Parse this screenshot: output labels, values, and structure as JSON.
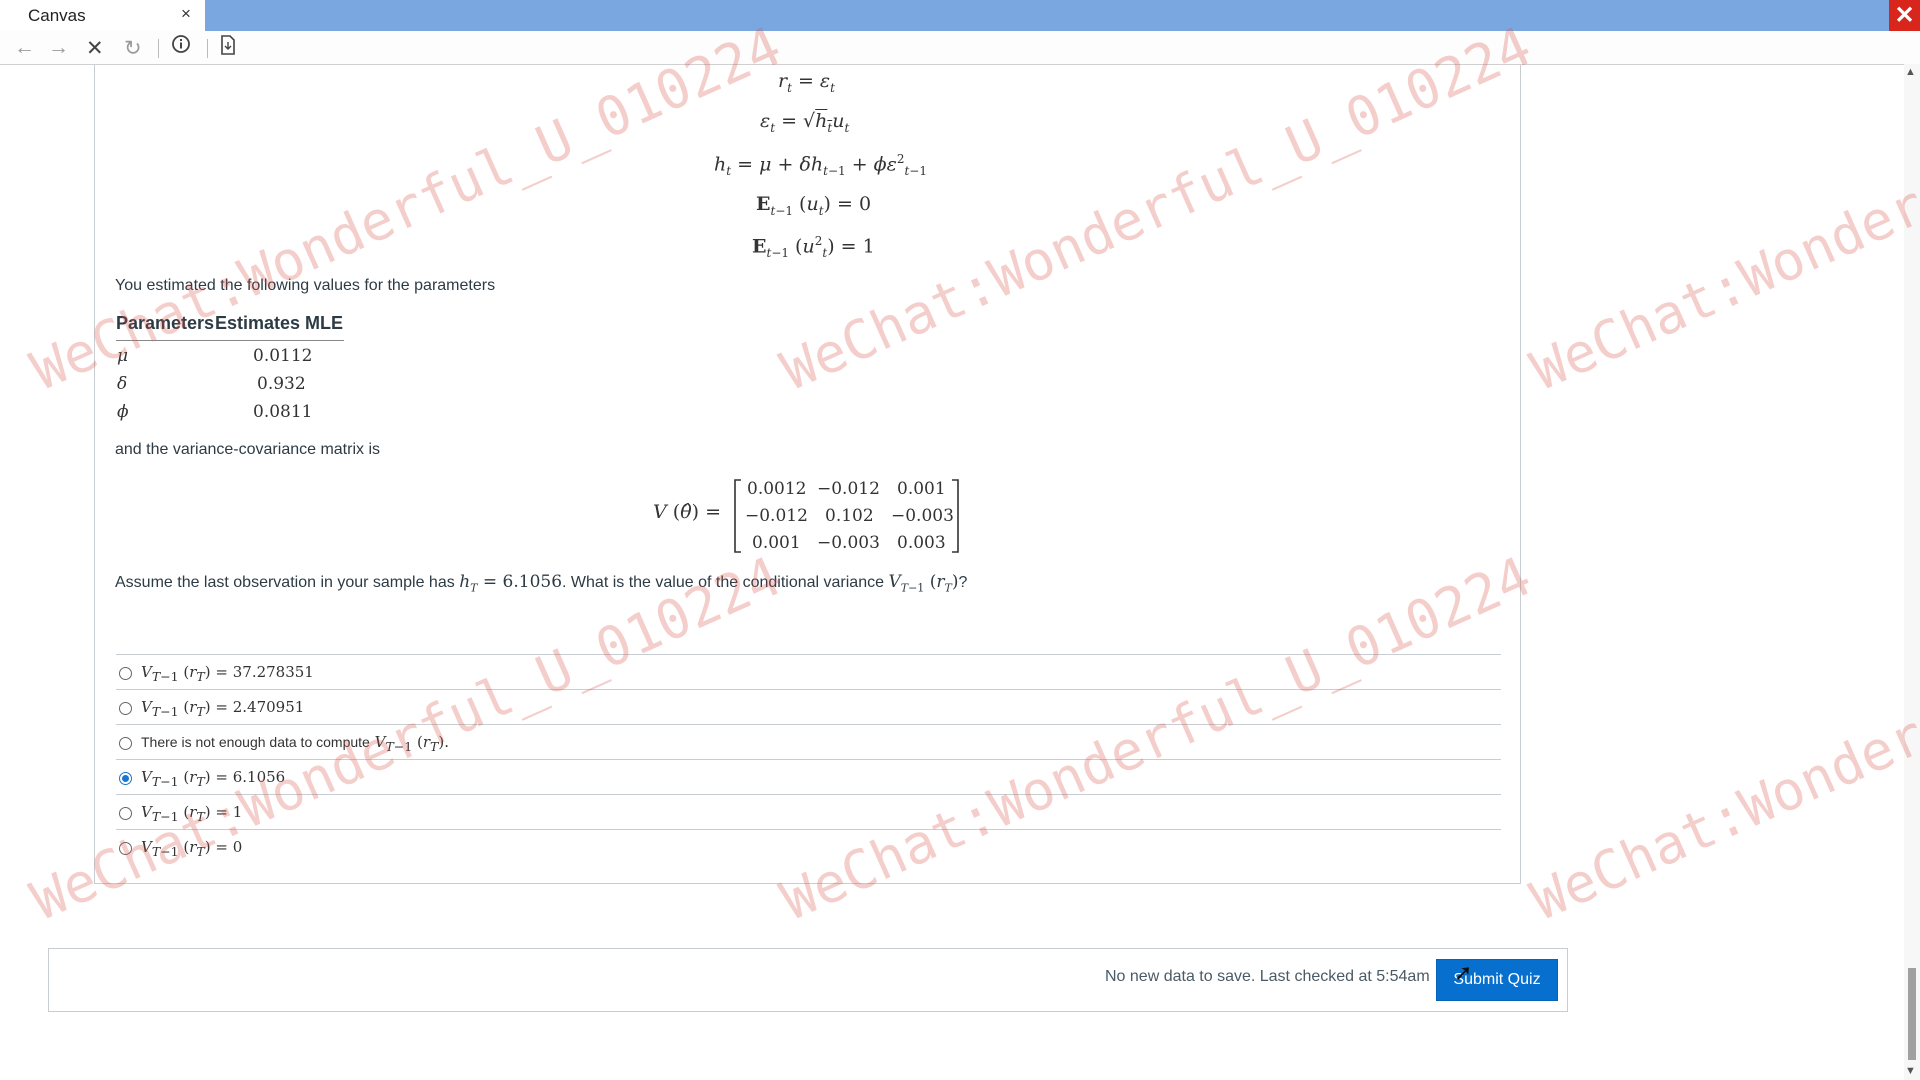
{
  "browser": {
    "tab_title": "Canvas",
    "tab_close": "×",
    "window_close": "✕",
    "icons": [
      "back-arrow-icon",
      "forward-arrow-icon",
      "stop-icon",
      "reload-icon",
      "info-icon",
      "page-icon"
    ]
  },
  "question": {
    "intro": "You estimated the following values for the parameters",
    "table": {
      "headers": [
        "Parameters",
        "Estimates MLE"
      ],
      "rows": [
        {
          "param": "μ",
          "estimate": "0.0112"
        },
        {
          "param": "δ",
          "estimate": "0.932"
        },
        {
          "param": "ϕ",
          "estimate": "0.0811"
        }
      ]
    },
    "matrix_intro": "and the variance-covariance matrix is",
    "matrix": [
      [
        "0.0012",
        "−0.012",
        "0.001"
      ],
      [
        "−0.012",
        "0.102",
        "−0.003"
      ],
      [
        "0.001",
        "−0.003",
        "0.003"
      ]
    ],
    "prompt_part1": "Assume the last observation in your sample has",
    "prompt_ht_value": "6.1056",
    "prompt_part2": "What is the value of the conditional variance",
    "options": [
      {
        "value": "37.278351",
        "text": "",
        "selected": false
      },
      {
        "value": "2.470951",
        "text": "",
        "selected": false
      },
      {
        "value": "",
        "text": "There is not enough data to compute",
        "selected": false
      },
      {
        "value": "6.1056",
        "text": "",
        "selected": true
      },
      {
        "value": "1",
        "text": "",
        "selected": false
      },
      {
        "value": "0",
        "text": "",
        "selected": false
      }
    ]
  },
  "footer": {
    "status": "No new data to save. Last checked at 5:54am",
    "submit_label": "Submit Quiz"
  },
  "watermark": "WeChat:Wonderful_U_010224",
  "colors": {
    "accent": "#0770cf",
    "titlebar": "#7ba7e1",
    "close": "#d9261c",
    "watermark": "#d65046"
  }
}
